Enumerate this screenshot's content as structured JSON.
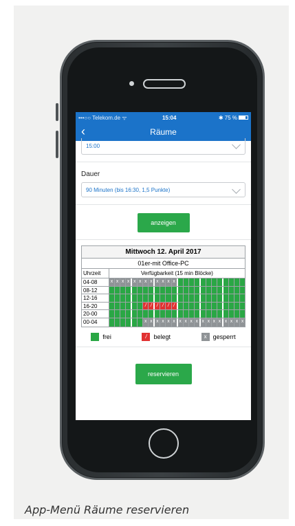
{
  "caption": "App-Menü Räume reservieren",
  "status_bar": {
    "carrier": "•••○○ Telekom.de ᯤ",
    "time": "15:04",
    "battery_text": "✱ 75 %"
  },
  "nav": {
    "back_icon": "chevron-left-icon",
    "title": "Räume"
  },
  "time_field": {
    "value": "15:00"
  },
  "duration": {
    "label": "Dauer",
    "value": "90 Minuten (bis 16:30, 1,5 Punkte)"
  },
  "show_button": "anzeigen",
  "schedule": {
    "date": "Mittwoch 12. April 2017",
    "room": "01er-mit Office-PC",
    "col_time": "Uhrzeit",
    "col_avail": "Verfügbarkeit (15 min Blöcke)",
    "rows": [
      {
        "label": "04-08",
        "cells": "ggggggggggggffffffffffff"
      },
      {
        "label": "08-12",
        "cells": "ffffffffffffffffffffffff"
      },
      {
        "label": "12-16",
        "cells": "ffffffffffffffffffffffff"
      },
      {
        "label": "16-20",
        "cells": "ffffffbbbbbbffffffffffff"
      },
      {
        "label": "20-00",
        "cells": "ffffffffffffffffffffffff"
      },
      {
        "label": "00-04",
        "cells": "ffffffgggggggggggggggggg"
      }
    ]
  },
  "legend": {
    "free": "frei",
    "booked": "belegt",
    "blocked": "gesperrt",
    "free_color": "#2aa745",
    "booked_color": "#e13232",
    "blocked_color": "#8f9396"
  },
  "reserve_button": "reservieren"
}
